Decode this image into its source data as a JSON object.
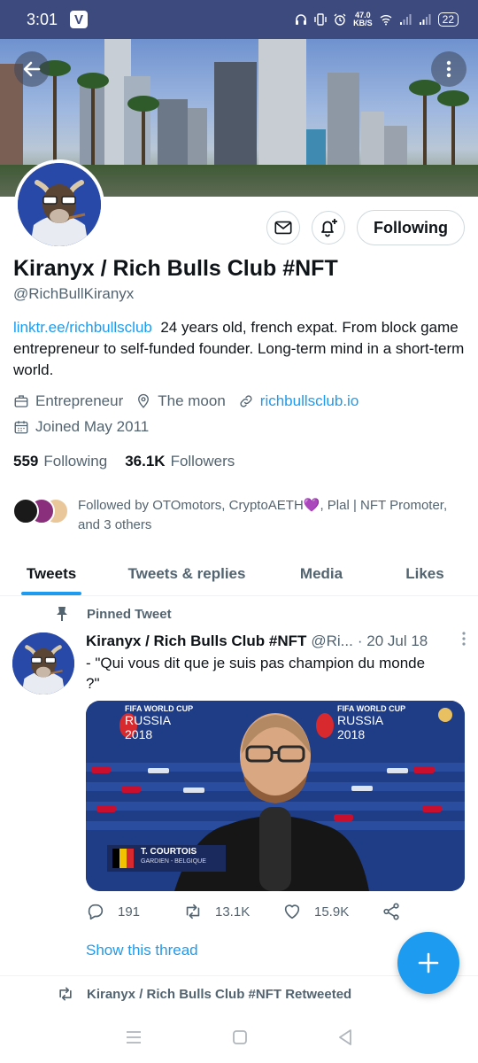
{
  "status_bar": {
    "time": "3:01",
    "net_speed_value": "47.0",
    "net_speed_unit": "KB/S",
    "battery": "22"
  },
  "profile": {
    "display_name": "Kiranyx / Rich Bulls Club #NFT",
    "handle": "@RichBullKiranyx",
    "bio_link": "linktr.ee/richbullsclub",
    "bio_text": "24 years old, french expat. From block game entrepreneur to self-funded founder.  Long-term mind in a short-term world.",
    "category": "Entrepreneur",
    "location": "The moon",
    "website": "richbullsclub.io",
    "joined": "Joined May 2011",
    "following_count": "559",
    "following_label": "Following",
    "followers_count": "36.1K",
    "followers_label": "Followers",
    "followed_by_text": "Followed by OTOmotors, CryptoAETH💜, Plal | NFT Promoter, and 3 others"
  },
  "buttons": {
    "following": "Following"
  },
  "tabs": [
    {
      "label": "Tweets",
      "active": true
    },
    {
      "label": "Tweets & replies",
      "active": false
    },
    {
      "label": "Media",
      "active": false
    },
    {
      "label": "Likes",
      "active": false
    }
  ],
  "tweet": {
    "pinned_label": "Pinned Tweet",
    "author_name": "Kiranyx / Rich Bulls Club #NFT",
    "author_handle": "@Ri...",
    "date": "· 20 Jul 18",
    "text": "- \"Qui vous dit que je suis pas champion du monde ?\"",
    "media": {
      "event_line1": "FIFA WORLD CUP",
      "event_line2": "RUSSIA",
      "event_line3": "2018",
      "caption_name": "T. COURTOIS",
      "caption_sub": "GARDIEN - BELGIQUE"
    },
    "replies": "191",
    "retweets": "13.1K",
    "likes": "15.9K",
    "show_thread": "Show this thread"
  },
  "next_item": {
    "retweeted_label": "Kiranyx / Rich Bulls Club #NFT Retweeted"
  },
  "colors": {
    "accent": "#1d9bf0",
    "status_bar": "#3d4a7e",
    "text_secondary": "#536471"
  },
  "icons": [
    "back-arrow-icon",
    "more-vertical-icon",
    "mail-icon",
    "bell-plus-icon",
    "briefcase-icon",
    "location-pin-icon",
    "link-icon",
    "calendar-icon",
    "pin-icon",
    "reply-icon",
    "retweet-icon",
    "heart-icon",
    "share-icon",
    "compose-plus-icon"
  ]
}
